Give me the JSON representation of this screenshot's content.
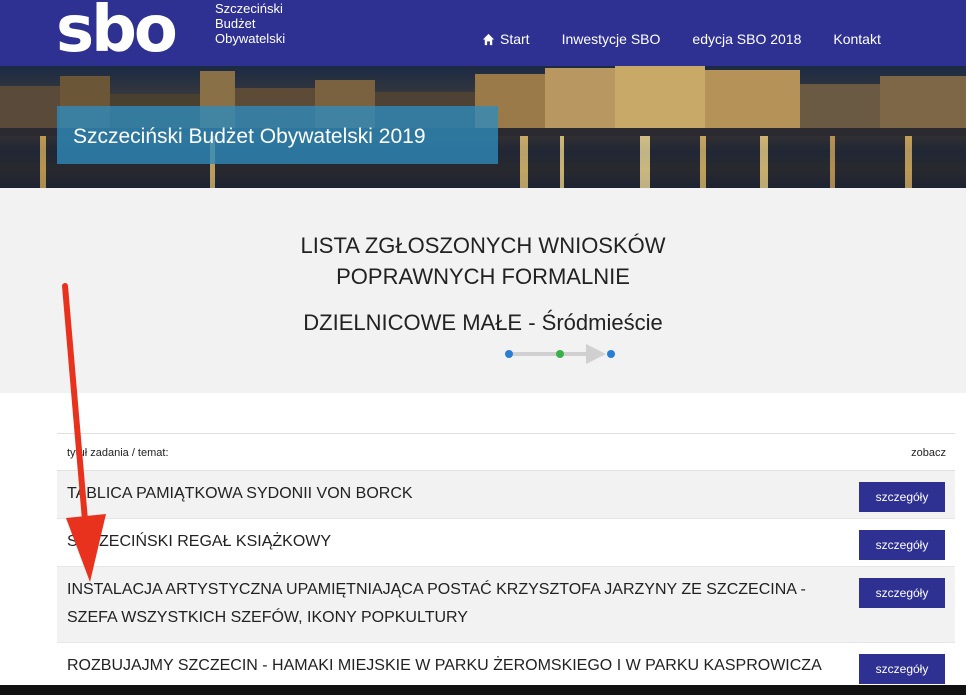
{
  "header": {
    "logo": "sbo",
    "logo_lines": [
      "Szczeciński",
      "Budżet",
      "Obywatelski"
    ],
    "nav": [
      {
        "label": "Start",
        "icon": "home-icon"
      },
      {
        "label": "Inwestycje SBO"
      },
      {
        "label": "edycja SBO 2018"
      },
      {
        "label": "Kontakt"
      }
    ]
  },
  "banner": {
    "title": "Szczeciński Budżet Obywatelski 2019"
  },
  "headline": {
    "line1": "LISTA ZGŁOSZONYCH WNIOSKÓW",
    "line2": "POPRAWNYCH FORMALNIE",
    "line3": "DZIELNICOWE MAŁE - Śródmieście"
  },
  "table": {
    "col_title": "tytuł zadania / temat:",
    "col_view": "zobacz",
    "button_label": "szczegóły",
    "rows": [
      {
        "title": "TABLICA PAMIĄTKOWA SYDONII VON BORCK"
      },
      {
        "title": "SZCZECIŃSKI REGAŁ KSIĄŻKOWY"
      },
      {
        "title": "INSTALACJA ARTYSTYCZNA UPAMIĘTNIAJĄCA POSTAĆ KRZYSZTOFA JARZYNY ZE SZCZECINA - SZEFA WSZYSTKICH SZEFÓW, IKONY POPKULTURY"
      },
      {
        "title": "ROZBUJAJMY SZCZECIN - HAMAKI MIEJSKIE W PARKU ŻEROMSKIEGO I W PARKU KASPROWICZA"
      }
    ]
  },
  "colors": {
    "brand": "#2e3192",
    "banner_overlay": "#2e8cbe",
    "annotation_arrow": "#e8321e"
  }
}
